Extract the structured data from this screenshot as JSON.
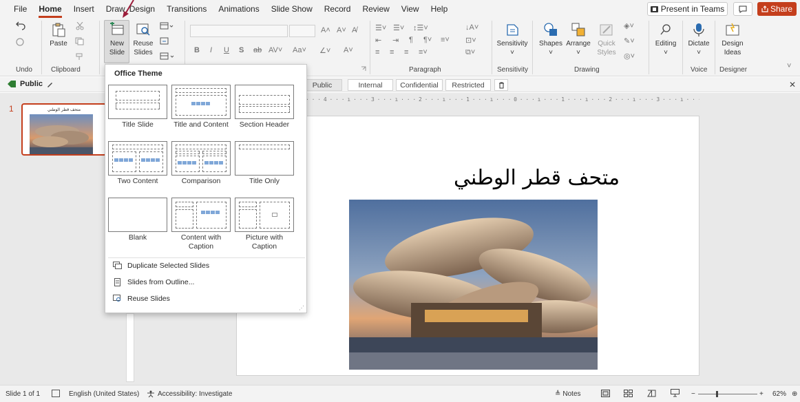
{
  "menu": {
    "tabs": [
      "File",
      "Home",
      "Insert",
      "Draw",
      "Design",
      "Transitions",
      "Animations",
      "Slide Show",
      "Record",
      "Review",
      "View",
      "Help"
    ],
    "present_label": "Present in Teams",
    "share_label": "Share"
  },
  "ribbon": {
    "undo_label": "Undo",
    "paste_label": "Paste",
    "clipboard_label": "Clipboard",
    "new_slide_label_1": "New",
    "new_slide_label_2": "Slide",
    "reuse_label_1": "Reuse",
    "reuse_label_2": "Slides",
    "bold": "B",
    "italic": "I",
    "underline": "U",
    "strike": "S",
    "paragraph_label": "Paragraph",
    "sensitivity_label": "Sensitivity",
    "shapes_label": "Shapes",
    "arrange_label": "Arrange",
    "quick_styles_1": "Quick",
    "quick_styles_2": "Styles",
    "drawing_label": "Drawing",
    "editing_label": "Editing",
    "dictate_label": "Dictate",
    "voice_label": "Voice",
    "design_ideas_1": "Design",
    "design_ideas_2": "Ideas",
    "designer_label": "Designer"
  },
  "sensitivity_bar": {
    "current": "Public",
    "tags": [
      "Public",
      "Internal",
      "Confidential",
      "Restricted"
    ]
  },
  "thumbnail": {
    "number": "1",
    "title": "متحف قطر الوطني"
  },
  "slide": {
    "title": "متحف قطر الوطني"
  },
  "new_slide_menu": {
    "header": "Office Theme",
    "layouts": [
      "Title Slide",
      "Title and Content",
      "Section Header",
      "Two Content",
      "Comparison",
      "Title Only",
      "Blank",
      "Content with Caption",
      "Picture with Caption"
    ],
    "actions": [
      "Duplicate Selected Slides",
      "Slides from Outline...",
      "Reuse Slides"
    ]
  },
  "status": {
    "slide_counter": "Slide 1 of 1",
    "language": "English (United States)",
    "accessibility": "Accessibility: Investigate",
    "notes": "Notes",
    "zoom": "62%"
  },
  "colors": {
    "accent": "#c43e1c",
    "ribbon_bg": "#f3f3f3"
  }
}
